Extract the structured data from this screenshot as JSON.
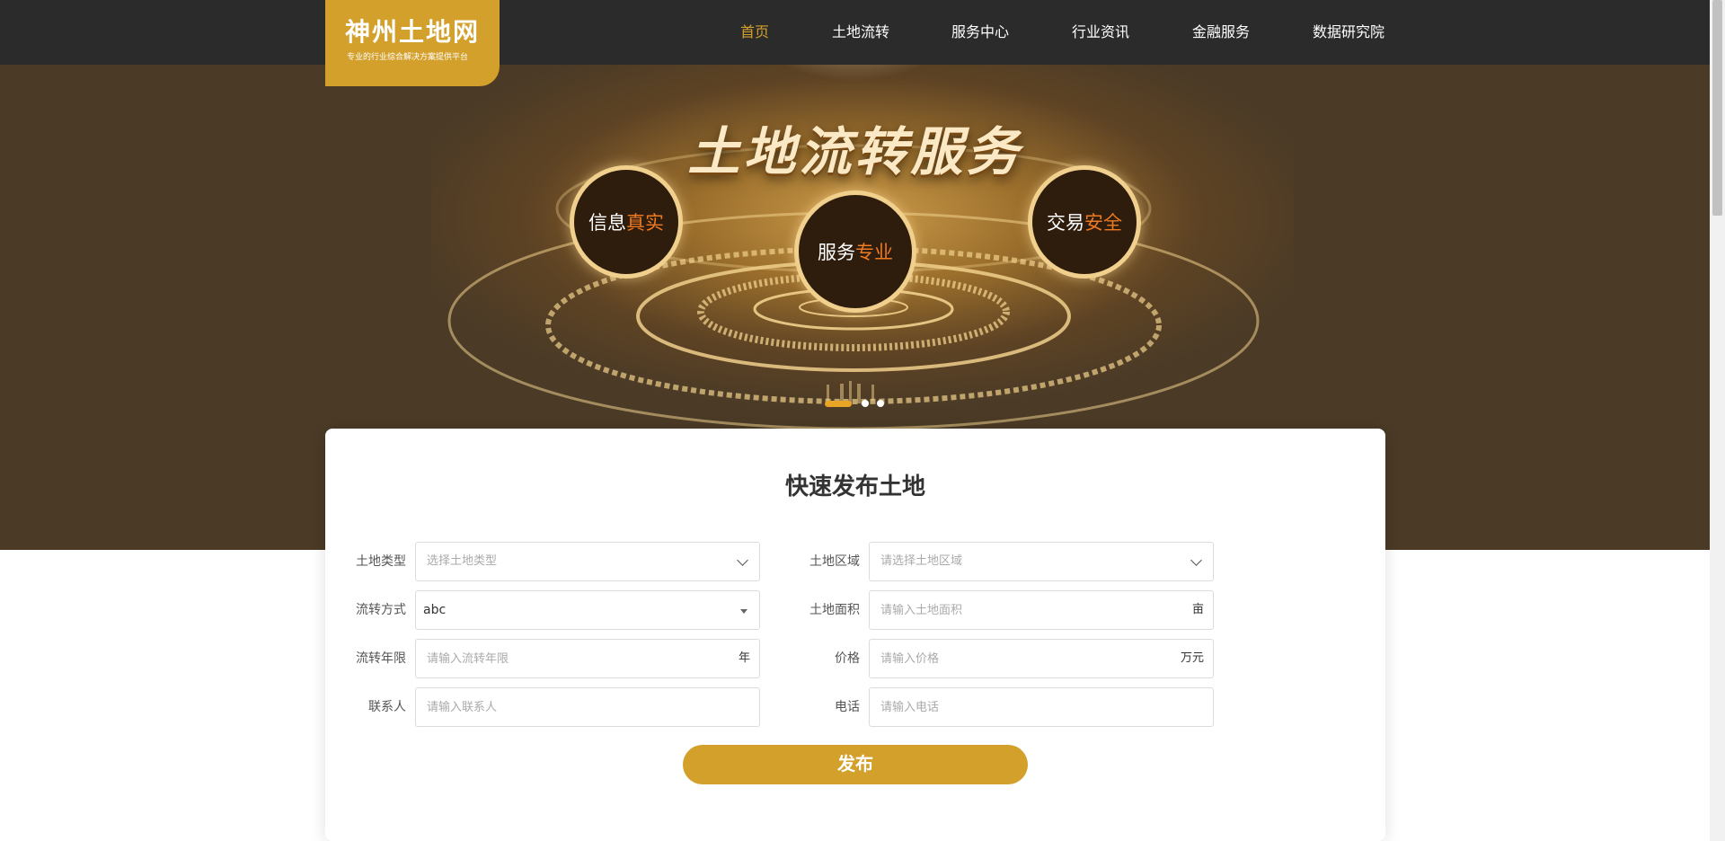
{
  "header": {
    "logo_title": "神州土地网",
    "logo_subtitle": "专业的行业综合解决方案提供平台",
    "nav": [
      "首页",
      "土地流转",
      "服务中心",
      "行业资讯",
      "金融服务",
      "数据研究院"
    ],
    "active_nav": "首页"
  },
  "hero": {
    "title": "土地流转服务",
    "badges": [
      {
        "plain": "信息",
        "highlight": "真实"
      },
      {
        "plain": "服务",
        "highlight": "专业"
      },
      {
        "plain": "交易",
        "highlight": "安全"
      }
    ],
    "slide_count": 3,
    "active_slide": 1
  },
  "form": {
    "title": "快速发布土地",
    "land_type": {
      "label": "土地类型",
      "placeholder": "选择土地类型"
    },
    "land_region": {
      "label": "土地区域",
      "placeholder": "请选择土地区域"
    },
    "transfer_method": {
      "label": "流转方式",
      "value": "abc"
    },
    "land_area": {
      "label": "土地面积",
      "placeholder": "请输入土地面积",
      "unit": "亩"
    },
    "transfer_years": {
      "label": "流转年限",
      "placeholder": "请输入流转年限",
      "unit": "年"
    },
    "price": {
      "label": "价格",
      "placeholder": "请输入价格",
      "unit": "万元"
    },
    "contact": {
      "label": "联系人",
      "placeholder": "请输入联系人"
    },
    "phone": {
      "label": "电话",
      "placeholder": "请输入电话"
    },
    "submit_label": "发布"
  },
  "colors": {
    "brand": "#d4a02c",
    "header_bg": "#2b2b2b",
    "highlight": "#ee7a22"
  }
}
